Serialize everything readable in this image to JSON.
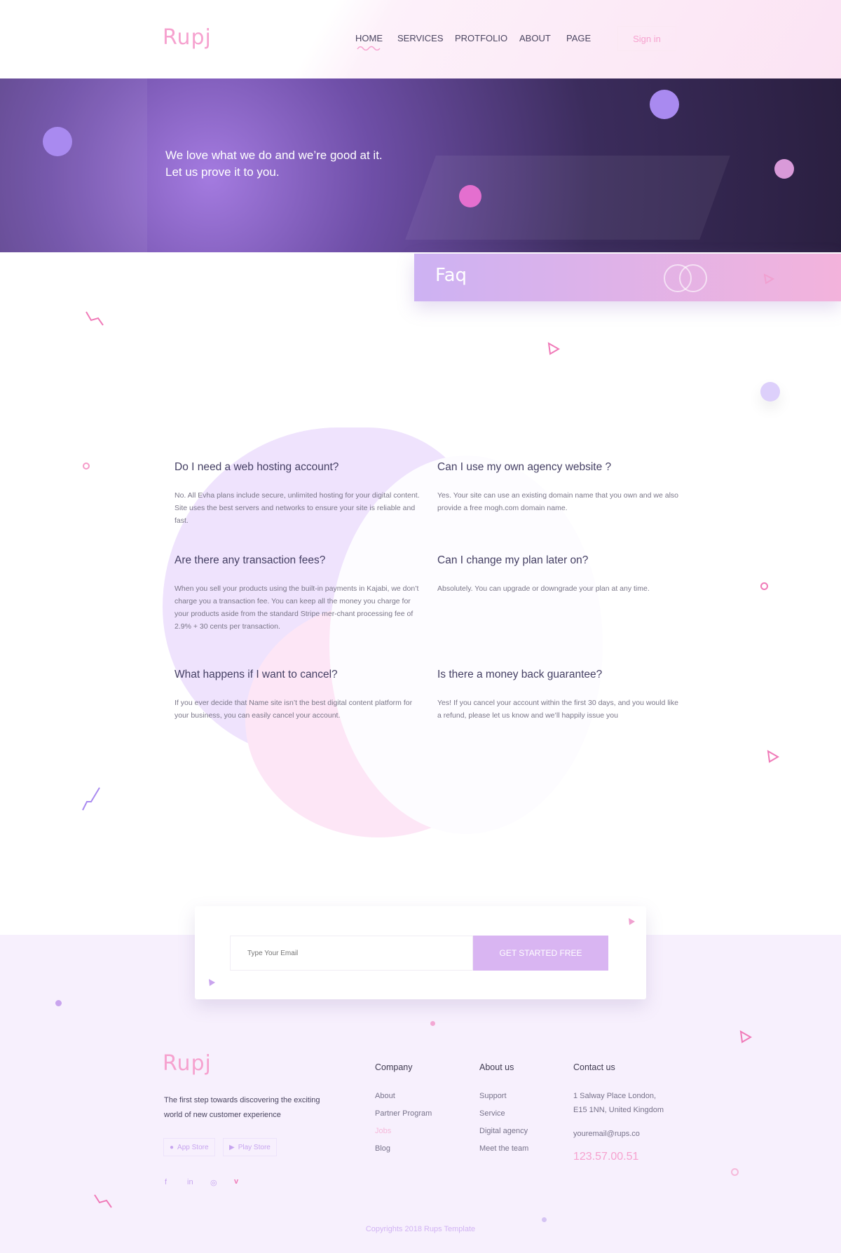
{
  "brand": {
    "logo": "Rupj"
  },
  "nav": {
    "items": [
      "HOME",
      "SERVICES",
      "PROTFOLIO",
      "ABOUT",
      "PAGE"
    ],
    "active": "HOME",
    "signin": "Sign in"
  },
  "hero": {
    "line1": "We love what we do and we’re good at it.",
    "line2": "Let us prove it to you."
  },
  "faq": {
    "title": "Faq",
    "items": [
      {
        "q": "Do I need a web hosting account?",
        "a": "No. All Evha plans include secure, unlimited hosting for your digital content. Site uses the best servers and networks to ensure your site is reliable and fast."
      },
      {
        "q": "Can I use my own agency website ?",
        "a": "Yes. Your site can use an existing domain name that you own and we also provide a free mogh.com domain name."
      },
      {
        "q": "Are there any transaction fees?",
        "a": "When you sell your products using the built-in payments in Kajabi, we don’t charge you a transaction fee. You can keep all the money you charge for your products aside from the standard Stripe mer-chant processing fee of 2.9% + 30 cents per transaction."
      },
      {
        "q": "Can I change my plan later on?",
        "a": "Absolutely. You can upgrade or downgrade your plan at any time."
      },
      {
        "q": "What happens if I want to cancel?",
        "a": "If you ever decide that Name site isn’t the best digital content platform for your business, you can easily cancel your account."
      },
      {
        "q": "Is there a money back guarantee?",
        "a": "Yes! If you cancel your account within the first 30 days, and you would like a refund, please let us know and we’ll happily issue you"
      }
    ]
  },
  "cta": {
    "placeholder": "Type Your Email",
    "button": "GET STARTED FREE"
  },
  "footer": {
    "logo": "Rupj",
    "tagline": "The first step towards discovering the exciting world of new customer experience",
    "stores": [
      "App Store",
      "Play Store"
    ],
    "social": [
      "facebook-icon",
      "linkedin-icon",
      "dribbble-icon",
      "vimeo-icon"
    ],
    "company": {
      "title": "Company",
      "links": [
        "About",
        "Partner Program",
        "Jobs",
        "Blog"
      ]
    },
    "about": {
      "title": "About us",
      "links": [
        "Support",
        "Service",
        "Digital agency",
        "Meet the team"
      ]
    },
    "contact": {
      "title": "Contact us",
      "address1": "1 Salway Place London,",
      "address2": "E15 1NN, United Kingdom",
      "email": "youremail@rups.co",
      "phone": "123.57.00.51"
    },
    "copyright": "Copyrights 2018 Rups Template"
  },
  "colors": {
    "pink": "#f6a2cf",
    "lavender": "#c9a4ee",
    "button": "#d9b5f2",
    "footer_bg": "#f7f0fd"
  }
}
